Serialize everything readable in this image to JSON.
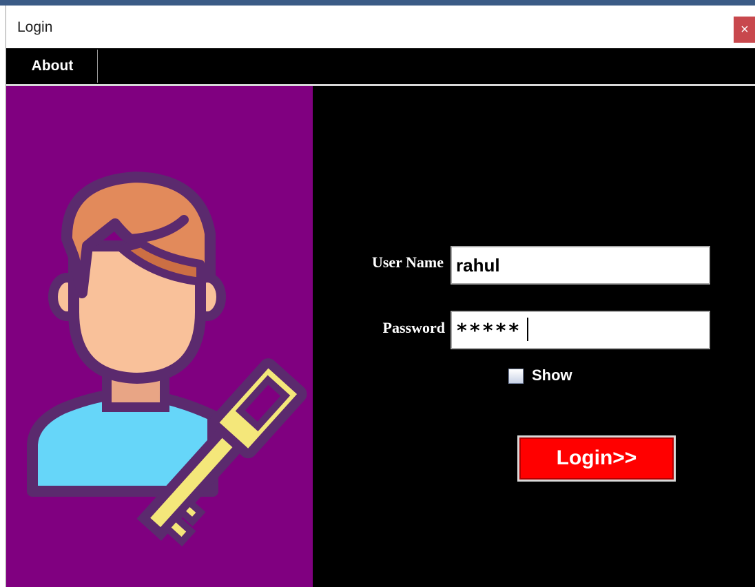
{
  "window": {
    "title": "Login",
    "close_label": "×"
  },
  "menu": {
    "items": [
      {
        "label": "About"
      }
    ]
  },
  "form": {
    "username": {
      "label": "User Name",
      "value": "rahul"
    },
    "password": {
      "label": "Password",
      "value": "*****"
    },
    "show_password": {
      "label": "Show",
      "checked": false
    },
    "submit_label": "Login>>"
  },
  "illustration": {
    "icon": "user-with-key-icon"
  },
  "colors": {
    "left_panel": "#800080",
    "right_panel": "#000000",
    "button": "#ff0000",
    "menubar": "#000000",
    "close_button": "#c8484d"
  }
}
